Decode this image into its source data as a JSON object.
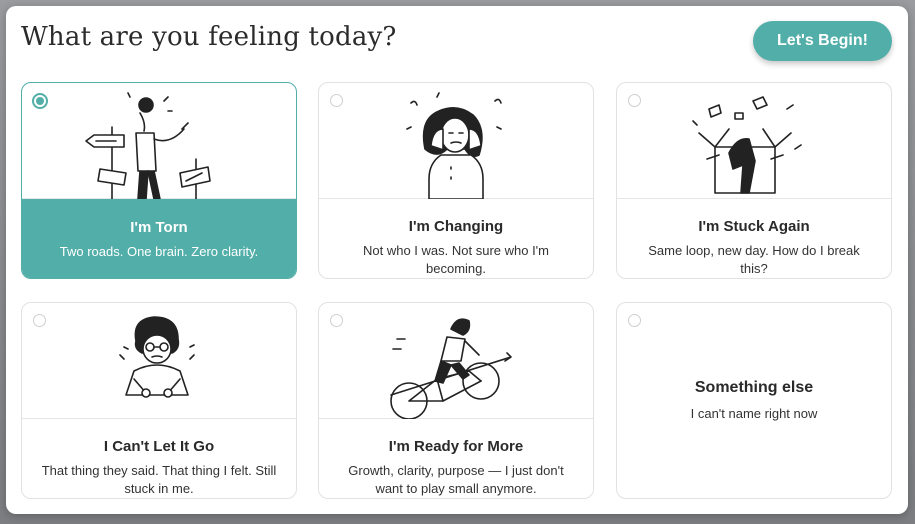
{
  "title": "What are you feeling today?",
  "begin_button": "Let's Begin!",
  "colors": {
    "accent": "#52aea8",
    "border": "#e2e2e2",
    "text": "#2a2a2a"
  },
  "cards": [
    {
      "title": "I'm Torn",
      "description": "Two roads. One brain. Zero clarity.",
      "selected": true,
      "icon": "signpost-illustration"
    },
    {
      "title": "I'm Changing",
      "description": "Not who I was. Not sure who I'm becoming.",
      "selected": false,
      "icon": "overwhelmed-person-illustration"
    },
    {
      "title": "I'm Stuck Again",
      "description": "Same loop, new day. How do I break this?",
      "selected": false,
      "icon": "box-stuck-illustration"
    },
    {
      "title": "I Can't Let It Go",
      "description": "That thing they said. That thing I felt. Still stuck in me.",
      "selected": false,
      "icon": "anxious-person-illustration"
    },
    {
      "title": "I'm Ready for More",
      "description": "Growth, clarity, purpose — I just don't want to play small anymore.",
      "selected": false,
      "icon": "cyclist-illustration"
    },
    {
      "title": "Something else",
      "description": "I can't name right now",
      "selected": false,
      "icon": ""
    }
  ]
}
